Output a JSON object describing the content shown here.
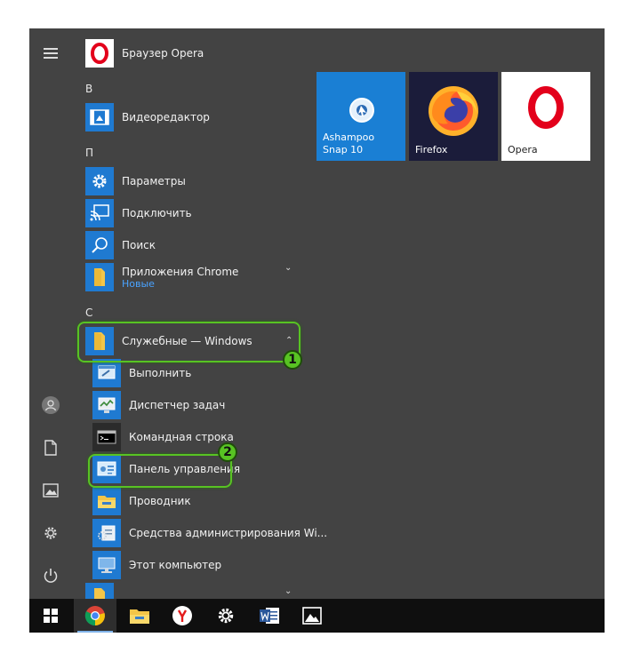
{
  "start_menu": {
    "apps": [
      {
        "id": "opera",
        "label": "Браузер Opera"
      },
      {
        "id": "letter_v",
        "label": "В"
      },
      {
        "id": "video_editor",
        "label": "Видеоредактор"
      },
      {
        "id": "letter_p",
        "label": "П"
      },
      {
        "id": "settings",
        "label": "Параметры"
      },
      {
        "id": "connect",
        "label": "Подключить"
      },
      {
        "id": "search",
        "label": "Поиск"
      },
      {
        "id": "chrome_apps",
        "label": "Приложения Chrome",
        "sub": "Новые"
      },
      {
        "id": "letter_s",
        "label": "С"
      },
      {
        "id": "windows_system",
        "label": "Служебные — Windows"
      },
      {
        "id": "run",
        "label": "Выполнить"
      },
      {
        "id": "task_manager",
        "label": "Диспетчер задач"
      },
      {
        "id": "cmd",
        "label": "Командная строка"
      },
      {
        "id": "control_panel",
        "label": "Панель управления"
      },
      {
        "id": "explorer",
        "label": "Проводник"
      },
      {
        "id": "admin_tools",
        "label": "Средства администрирования Wi..."
      },
      {
        "id": "this_pc",
        "label": "Этот компьютер"
      }
    ],
    "tiles": [
      {
        "id": "ashampoo",
        "label": "Ashampoo\nSnap 10"
      },
      {
        "id": "firefox",
        "label": "Firefox"
      },
      {
        "id": "opera_tile",
        "label": "Opera"
      }
    ]
  },
  "badges": {
    "one": "1",
    "two": "2"
  },
  "colors": {
    "accent": "#1f7ad1",
    "highlight": "#58c323",
    "menu_bg": "#434343",
    "taskbar": "#0f0f0f"
  }
}
